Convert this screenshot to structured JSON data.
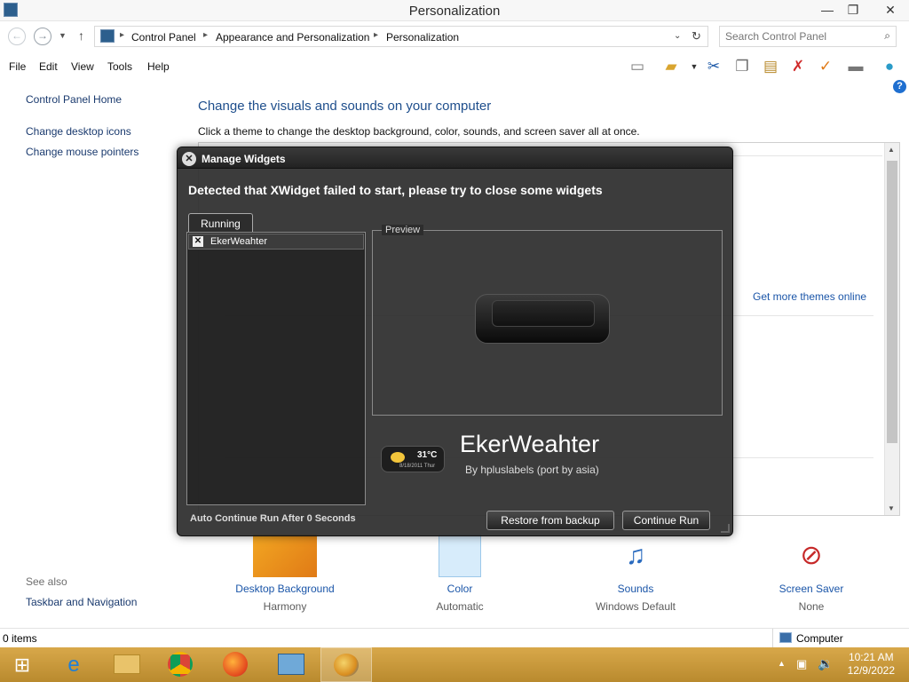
{
  "window": {
    "title": "Personalization"
  },
  "window_controls": {
    "minimize": "—",
    "restore": "❐",
    "close": "✕"
  },
  "address": {
    "crumbs": [
      "Control Panel",
      "Appearance and Personalization",
      "Personalization"
    ],
    "search_placeholder": "Search Control Panel"
  },
  "menu": [
    "File",
    "Edit",
    "View",
    "Tools",
    "Help"
  ],
  "left_pane": {
    "home": "Control Panel Home",
    "links": [
      "Change desktop icons",
      "Change mouse pointers"
    ],
    "see_also_label": "See also",
    "see_also_links": [
      "Taskbar and Navigation"
    ]
  },
  "main": {
    "heading": "Change the visuals and sounds on your computer",
    "subtext": "Click a theme to change the desktop background, color, sounds, and screen saver all at once.",
    "get_more": "Get more themes online",
    "bottom_items": [
      {
        "label": "Desktop Background",
        "sub": "Harmony"
      },
      {
        "label": "Color",
        "sub": "Automatic"
      },
      {
        "label": "Sounds",
        "sub": "Windows Default"
      },
      {
        "label": "Screen Saver",
        "sub": "None"
      }
    ]
  },
  "status": {
    "items": "0 items",
    "location": "Computer"
  },
  "taskbar": {
    "time": "10:21 AM",
    "date": "12/9/2022"
  },
  "dialog": {
    "title": "Manage Widgets",
    "message": "Detected that XWidget failed to start, please try to close some widgets",
    "tab": "Running",
    "widgets": [
      {
        "name": "EkerWeahter",
        "checked": true
      }
    ],
    "preview_label": "Preview",
    "widget_title": "EkerWeahter",
    "widget_author": "By hpluslabels (port by asia)",
    "weather_temp": "31°C",
    "weather_date": "8/18/2011 Thur",
    "auto_continue": "Auto Continue Run After 0 Seconds",
    "restore_button": "Restore from backup",
    "continue_button": "Continue Run"
  }
}
